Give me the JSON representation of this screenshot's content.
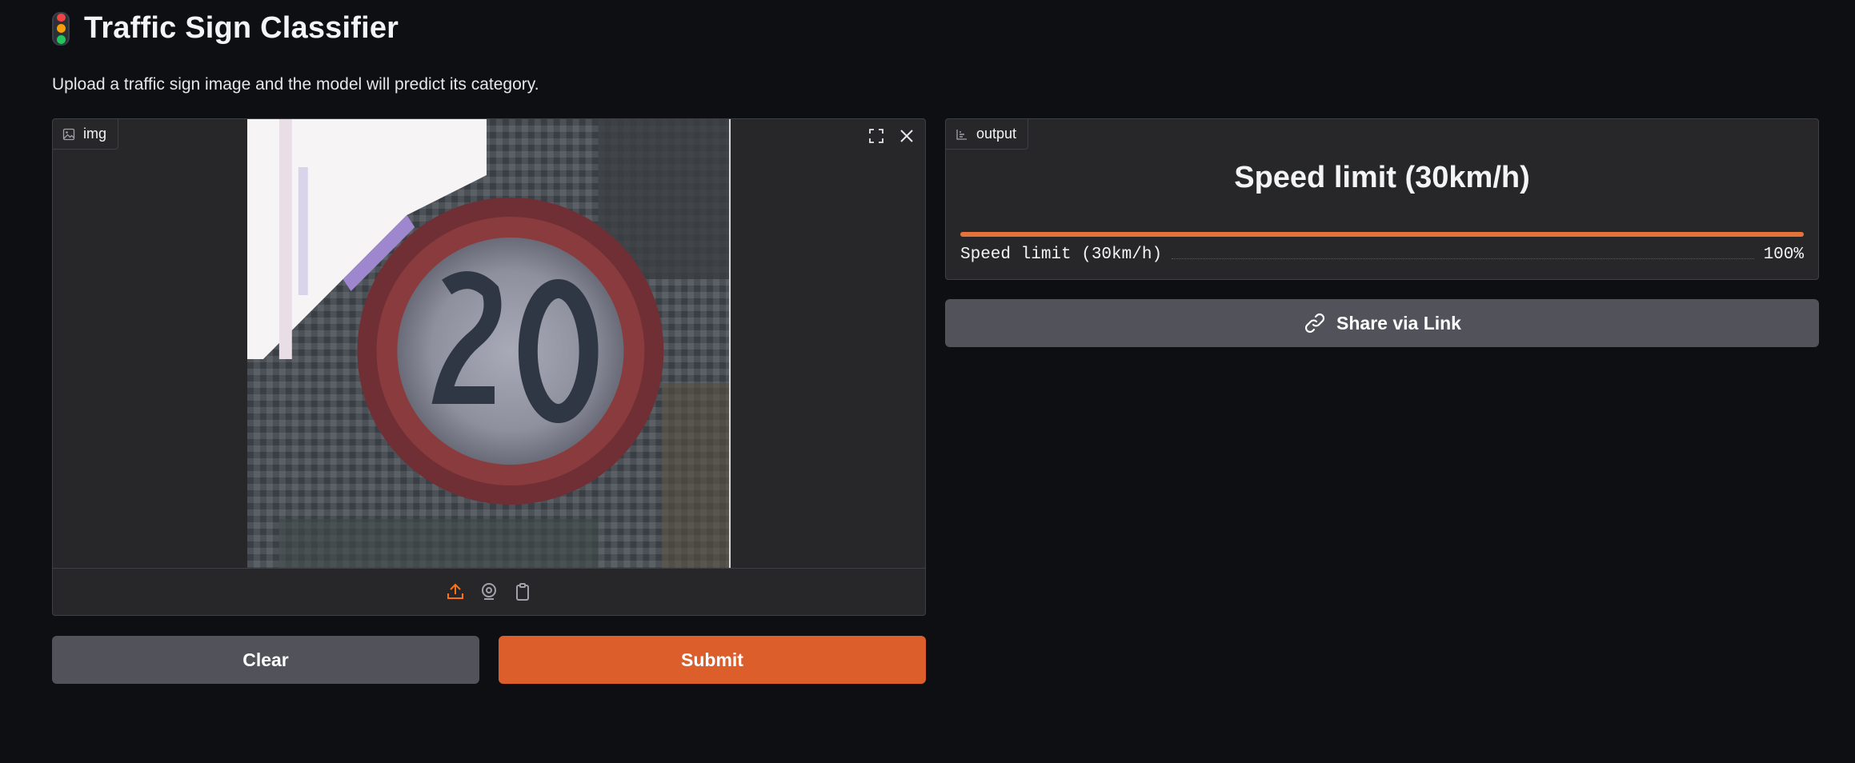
{
  "app": {
    "title": "Traffic Sign Classifier",
    "description": "Upload a traffic sign image and the model will predict its category.",
    "title_icon": "traffic-light-emoji"
  },
  "input": {
    "label": "img",
    "label_icon": "image-icon",
    "controls": [
      "fullscreen-icon",
      "close-icon"
    ],
    "sources": [
      "upload-icon",
      "webcam-icon",
      "clipboard-icon"
    ]
  },
  "output": {
    "label": "output",
    "label_icon": "bar-chart-icon",
    "predicted_label": "Speed limit (30km/h)",
    "confidences": [
      {
        "label": "Speed limit (30km/h)",
        "value_text": "100%",
        "value": 1.0
      }
    ]
  },
  "actions": {
    "clear_label": "Clear",
    "submit_label": "Submit",
    "share_label": "Share via Link"
  },
  "colors": {
    "accent": "#dc5f2b",
    "bar": "#e4733a",
    "background": "#0e0f12",
    "panel": "#27272a",
    "secondary_button": "#52525b"
  }
}
